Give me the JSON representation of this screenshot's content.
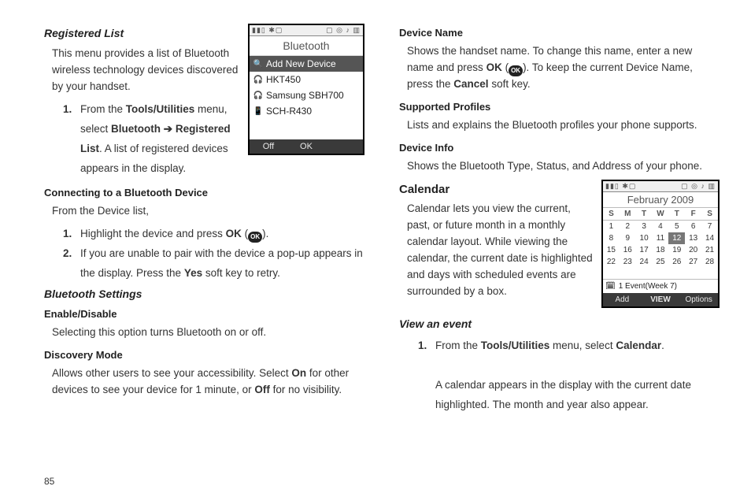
{
  "page_number": "85",
  "left": {
    "registered_list": {
      "heading": "Registered List",
      "intro": "This menu provides a list of Bluetooth wireless technology devices discovered by your handset.",
      "step1_pre": "From the ",
      "step1_b1": "Tools/Utilities",
      "step1_mid": " menu, select ",
      "step1_b2": "Bluetooth",
      "step1_arrow": " ➔ ",
      "step1_b3": "Registered List",
      "step1_post": ". A list of registered devices appears in the display."
    },
    "connecting": {
      "heading": "Connecting to a Bluetooth Device",
      "intro": "From the Device list,",
      "step1_pre": "Highlight the device and press ",
      "step1_b1": "OK",
      "step1_post": " (",
      "step1_end": ").",
      "step2_pre": "If you are unable to pair with the device a pop-up appears in the display. Press the ",
      "step2_b1": "Yes",
      "step2_post": " soft key to retry."
    },
    "bt_settings": {
      "heading": "Bluetooth Settings",
      "enable_heading": "Enable/Disable",
      "enable_body": "Selecting this option turns Bluetooth on or off.",
      "discovery_heading": "Discovery Mode",
      "discovery_pre": "Allows other users to see your accessibility. Select ",
      "discovery_on": "On",
      "discovery_mid": " for other devices to see your device for 1 minute, or ",
      "discovery_off": "Off",
      "discovery_post": " for no visibility."
    },
    "bt_screen": {
      "title": "Bluetooth",
      "add_new": "Add New Device",
      "items": [
        "HKT450",
        "Samsung SBH700",
        "SCH-R430"
      ],
      "soft_left": "Off",
      "soft_center": "OK"
    }
  },
  "right": {
    "device_name": {
      "heading": "Device Name",
      "pre": "Shows the handset name. To change this name, enter a new name and press ",
      "ok": "OK",
      "mid1": " (",
      "mid2": "). To keep the current Device Name, press the ",
      "cancel": "Cancel",
      "post": " soft key."
    },
    "profiles": {
      "heading": "Supported Profiles",
      "body": "Lists and explains the Bluetooth profiles your phone supports."
    },
    "device_info": {
      "heading": "Device Info",
      "body": "Shows the Bluetooth Type, Status, and Address of your phone."
    },
    "calendar": {
      "heading": "Calendar",
      "intro": "Calendar lets you view the current, past, or future month in a monthly calendar layout. While viewing the calendar, the current date is highlighted and days with scheduled events are surrounded by a box.",
      "view_heading": "View an event",
      "step1_pre": "From the ",
      "step1_b1": "Tools/Utilities",
      "step1_mid": " menu, select ",
      "step1_b2": "Calendar",
      "step1_post": ".",
      "step1_line2": "A calendar appears in the display with the current date highlighted. The month and year also appear."
    },
    "cal_screen": {
      "title": "February 2009",
      "dow": [
        "S",
        "M",
        "T",
        "W",
        "T",
        "F",
        "S"
      ],
      "rows": [
        [
          "1",
          "2",
          "3",
          "4",
          "5",
          "6",
          "7"
        ],
        [
          "8",
          "9",
          "10",
          "11",
          "12",
          "13",
          "14"
        ],
        [
          "15",
          "16",
          "17",
          "18",
          "19",
          "20",
          "21"
        ],
        [
          "22",
          "23",
          "24",
          "25",
          "26",
          "27",
          "28"
        ]
      ],
      "today": "12",
      "event_line": "1 Event(Week 7)",
      "soft_left": "Add",
      "soft_center": "VIEW",
      "soft_right": "Options"
    }
  }
}
